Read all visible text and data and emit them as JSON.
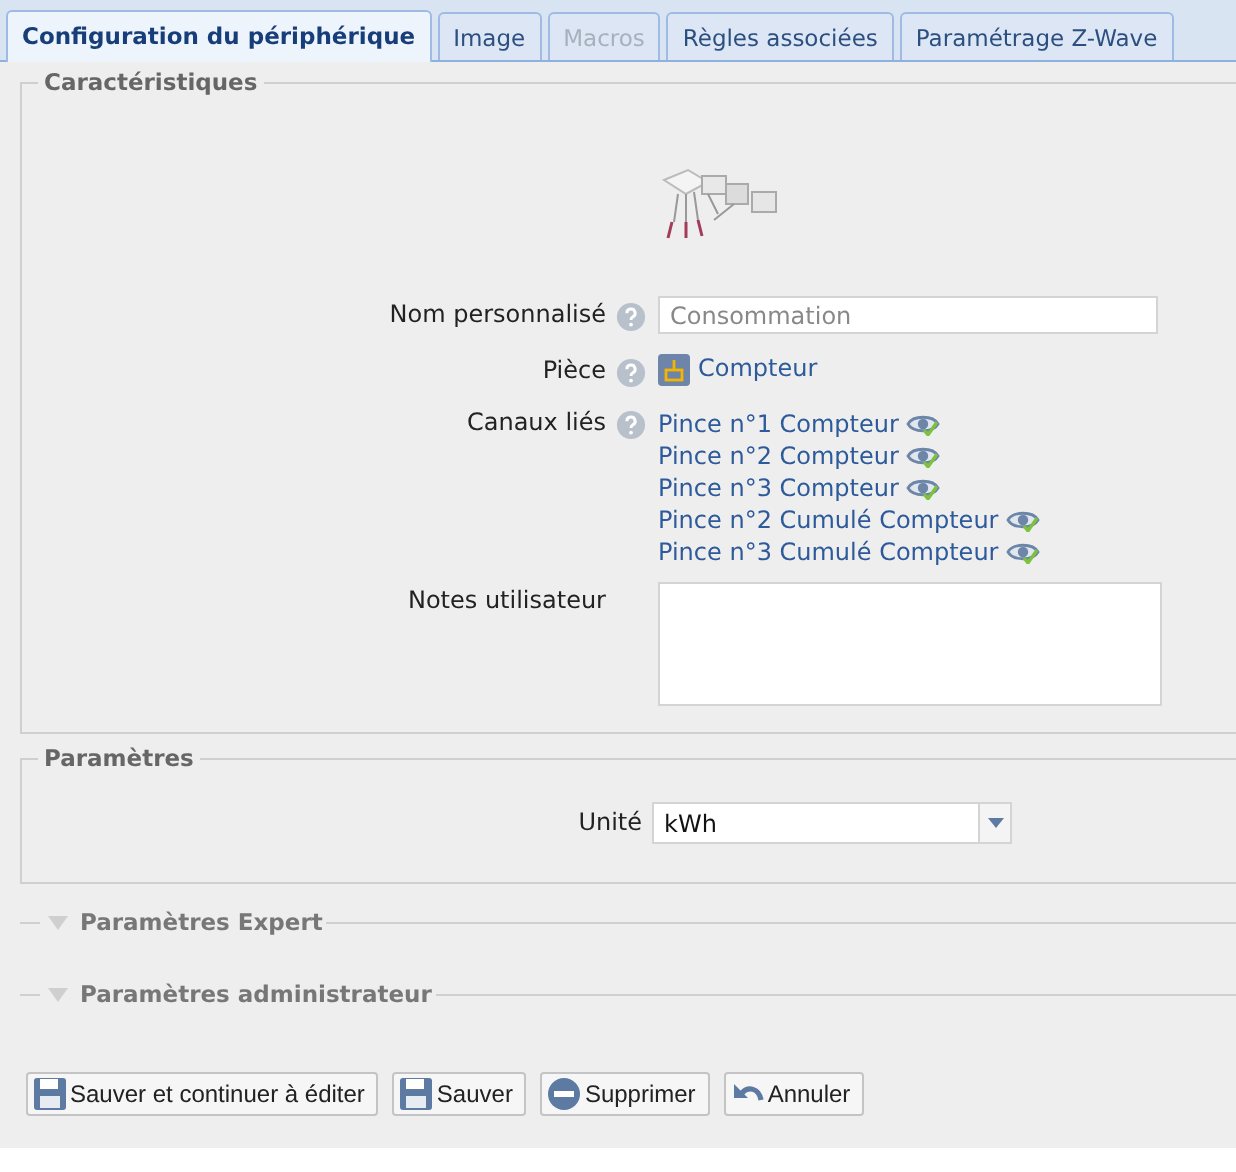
{
  "tabs": [
    {
      "label": "Configuration du périphérique",
      "selected": true,
      "disabled": false
    },
    {
      "label": "Image",
      "selected": false,
      "disabled": false
    },
    {
      "label": "Macros",
      "selected": false,
      "disabled": true
    },
    {
      "label": "Règles associées",
      "selected": false,
      "disabled": false
    },
    {
      "label": "Paramétrage Z-Wave",
      "selected": false,
      "disabled": false
    }
  ],
  "characteristics": {
    "legend": "Caractéristiques",
    "name": {
      "label": "Nom personnalisé",
      "placeholder": "Consommation"
    },
    "room": {
      "label": "Pièce",
      "value": "Compteur"
    },
    "channels": {
      "label": "Canaux liés",
      "items": [
        "Pince n°1 Compteur",
        "Pince n°2 Compteur",
        "Pince n°3 Compteur",
        "Pince n°2 Cumulé Compteur",
        "Pince n°3 Cumulé Compteur"
      ]
    },
    "notes": {
      "label": "Notes utilisateur"
    }
  },
  "parameters": {
    "legend": "Paramètres",
    "unit": {
      "label": "Unité",
      "value": "kWh"
    }
  },
  "collapsibles": [
    {
      "legend": "Paramètres Expert",
      "expanded": false
    },
    {
      "legend": "Paramètres administrateur",
      "expanded": false
    }
  ],
  "buttons": [
    {
      "label": "Sauver et continuer à éditer",
      "kind": "save"
    },
    {
      "label": "Sauver",
      "kind": "save"
    },
    {
      "label": "Supprimer",
      "kind": "delete"
    },
    {
      "label": "Annuler",
      "kind": "undo"
    }
  ]
}
